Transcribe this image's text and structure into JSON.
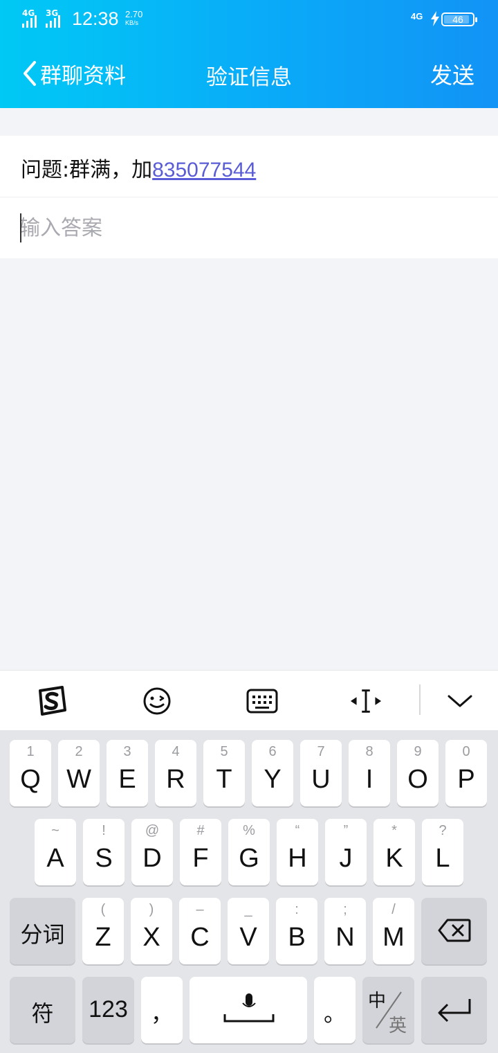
{
  "status_bar": {
    "net1": "4G",
    "net2": "3G",
    "time": "12:38",
    "speed_value": "2.70",
    "speed_unit": "KB/s",
    "net_right": "4G",
    "battery": "46"
  },
  "nav": {
    "back_label": "群聊资料",
    "title": "验证信息",
    "send_label": "发送"
  },
  "question": {
    "prefix": "问题:群满，加",
    "link": "835077544"
  },
  "answer": {
    "placeholder": "输入答案"
  },
  "toolbar": {
    "icons": [
      "sogou-logo-icon",
      "emoji-icon",
      "keyboard-icon",
      "cursor-move-icon",
      "chevron-down-icon"
    ]
  },
  "keyboard": {
    "row1": [
      {
        "m": "Q",
        "s": "1"
      },
      {
        "m": "W",
        "s": "2"
      },
      {
        "m": "E",
        "s": "3"
      },
      {
        "m": "R",
        "s": "4"
      },
      {
        "m": "T",
        "s": "5"
      },
      {
        "m": "Y",
        "s": "6"
      },
      {
        "m": "U",
        "s": "7"
      },
      {
        "m": "I",
        "s": "8"
      },
      {
        "m": "O",
        "s": "9"
      },
      {
        "m": "P",
        "s": "0"
      }
    ],
    "row2": [
      {
        "m": "A",
        "s": "~"
      },
      {
        "m": "S",
        "s": "!"
      },
      {
        "m": "D",
        "s": "@"
      },
      {
        "m": "F",
        "s": "#"
      },
      {
        "m": "G",
        "s": "%"
      },
      {
        "m": "H",
        "s": "“"
      },
      {
        "m": "J",
        "s": "”"
      },
      {
        "m": "K",
        "s": "*"
      },
      {
        "m": "L",
        "s": "?"
      }
    ],
    "row3": [
      {
        "m": "Z",
        "s": "("
      },
      {
        "m": "X",
        "s": ")"
      },
      {
        "m": "C",
        "s": "–"
      },
      {
        "m": "V",
        "s": "_"
      },
      {
        "m": "B",
        "s": ":"
      },
      {
        "m": "N",
        "s": ";"
      },
      {
        "m": "M",
        "s": "/"
      }
    ],
    "segment_label": "分词",
    "symbol_label": "符",
    "number_label": "123",
    "comma_label": "，",
    "period_label": "。",
    "lang_cn": "中",
    "lang_en": "英"
  }
}
